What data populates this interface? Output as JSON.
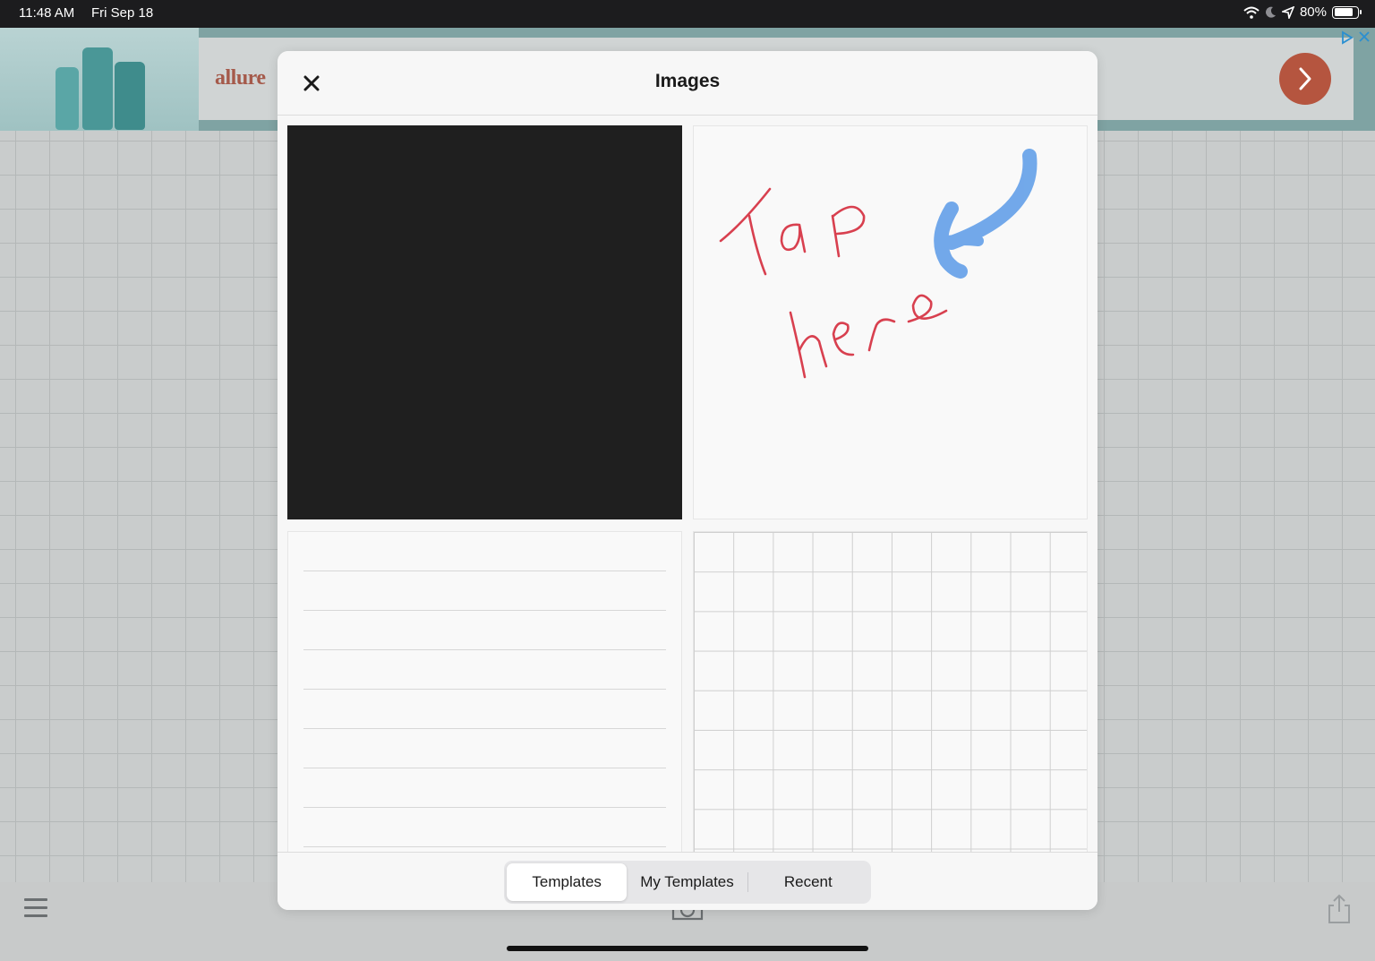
{
  "status_bar": {
    "time": "11:48 AM",
    "date": "Fri Sep 18",
    "battery": "80%",
    "battery_level": 0.8,
    "icons": [
      "wifi-icon",
      "moon-icon",
      "location-arrow-icon",
      "battery-icon"
    ]
  },
  "ad": {
    "brand": "allure",
    "go_icon": "chevron-right-icon",
    "accent": "#b5553f"
  },
  "modal": {
    "title": "Images",
    "close_icon": "close-icon",
    "templates": [
      {
        "id": "blank-dark"
      },
      {
        "id": "tap-here",
        "handwritten": "Tap here"
      },
      {
        "id": "lined-paper"
      },
      {
        "id": "grid-paper"
      }
    ],
    "tabs": [
      {
        "label": "Templates",
        "active": true
      },
      {
        "label": "My Templates",
        "active": false
      },
      {
        "label": "Recent",
        "active": false
      }
    ]
  },
  "toolbar": {
    "icons": [
      "menu-icon",
      "camera-icon",
      "share-icon"
    ]
  }
}
